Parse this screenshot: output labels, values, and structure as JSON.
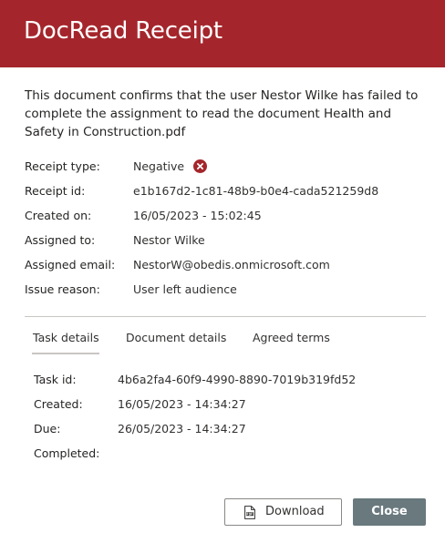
{
  "header": {
    "title": "DocRead Receipt",
    "color": "#a4262c"
  },
  "intro": "This document confirms that the user Nestor Wilke has failed to complete the assignment to read the document Health and Safety in Construction.pdf",
  "receipt": {
    "type_label": "Receipt type:",
    "type_value": "Negative",
    "type_icon": "error-circle-icon",
    "id_label": "Receipt id:",
    "id_value": "e1b167d2-1c81-48b9-b0e4-cada521259d8",
    "created_label": "Created on:",
    "created_value": "16/05/2023 - 15:02:45",
    "assigned_label": "Assigned to:",
    "assigned_value": "Nestor Wilke",
    "email_label": "Assigned email:",
    "email_value": "NestorW@obedis.onmicrosoft.com",
    "reason_label": "Issue reason:",
    "reason_value": "User left audience"
  },
  "tabs": {
    "items": [
      {
        "label": "Task details",
        "selected": true
      },
      {
        "label": "Document details",
        "selected": false
      },
      {
        "label": "Agreed terms",
        "selected": false
      }
    ]
  },
  "task": {
    "id_label": "Task id:",
    "id_value": "4b6a2fa4-60f9-4990-8890-7019b319fd52",
    "created_label": "Created:",
    "created_value": "16/05/2023 - 14:34:27",
    "due_label": "Due:",
    "due_value": "26/05/2023 - 14:34:27",
    "completed_label": "Completed:",
    "completed_value": ""
  },
  "footer": {
    "download_label": "Download",
    "download_icon": "pdf-document-icon",
    "close_label": "Close",
    "close_color": "#69797e"
  },
  "colors": {
    "error": "#a4262c",
    "divider": "#c8c6c4"
  }
}
